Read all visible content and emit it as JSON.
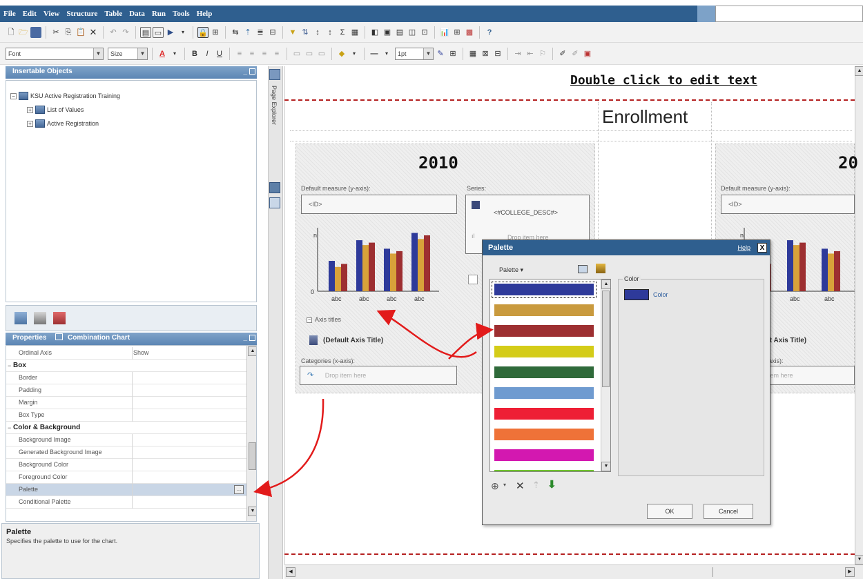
{
  "menu": {
    "items": [
      "File",
      "Edit",
      "View",
      "Structure",
      "Table",
      "Data",
      "Run",
      "Tools",
      "Help"
    ]
  },
  "format_toolbar": {
    "font_value": "Font",
    "size_value": "Size",
    "line_value": "1pt"
  },
  "insertable_objects": {
    "title": "Insertable Objects",
    "tree": [
      {
        "label": "KSU Active Registration Training",
        "level": 0,
        "expander": "−"
      },
      {
        "label": "List of Values",
        "level": 1,
        "expander": "+"
      },
      {
        "label": "Active Registration",
        "level": 1,
        "expander": "+"
      }
    ]
  },
  "page_explorer": {
    "label": "Page Explorer"
  },
  "properties": {
    "title": "Properties",
    "context": "Combination Chart",
    "rows": [
      {
        "name": "Ordinal Axis",
        "value": "Show",
        "group": false
      },
      {
        "name": "Box",
        "value": "",
        "group": true,
        "expander": "−"
      },
      {
        "name": "Border",
        "value": "",
        "group": false
      },
      {
        "name": "Padding",
        "value": "",
        "group": false
      },
      {
        "name": "Margin",
        "value": "",
        "group": false
      },
      {
        "name": "Box Type",
        "value": "",
        "group": false
      },
      {
        "name": "Color & Background",
        "value": "",
        "group": true,
        "expander": "−"
      },
      {
        "name": "Background Image",
        "value": "",
        "group": false
      },
      {
        "name": "Generated Background Image",
        "value": "",
        "group": false
      },
      {
        "name": "Background Color",
        "value": "",
        "group": false
      },
      {
        "name": "Foreground Color",
        "value": "",
        "group": false
      },
      {
        "name": "Palette",
        "value": "",
        "group": false,
        "selected": true
      },
      {
        "name": "Conditional Palette",
        "value": "",
        "group": false
      }
    ],
    "ellipsis": "...",
    "description_title": "Palette",
    "description_text": "Specifies the palette to use for the chart."
  },
  "report": {
    "header_text": "Double click to edit text",
    "enrollment_title": "Enrollment",
    "chart_left": {
      "year": "2010",
      "default_measure_label": "Default measure (y-axis):",
      "measure_value": "<ID>",
      "series_label": "Series:",
      "series_value": "<#COLLEGE_DESC#>",
      "series_drop": "Drop item here",
      "axis_n": "n",
      "axis_zero": "0",
      "x_labels": [
        "abc",
        "abc",
        "abc",
        "abc"
      ],
      "axis_titles_toggle": "Axis titles",
      "default_axis_title": "(Default Axis Title)",
      "categories_label": "Categories (x-axis):",
      "categories_drop": "Drop item here"
    },
    "chart_right": {
      "year": "20",
      "default_measure_label": "Default measure (y-axis):",
      "measure_value": "<ID>",
      "axis_n": "n",
      "x_labels": [
        "abc",
        "abc",
        "abc"
      ],
      "default_axis_title": "lt Axis Title)",
      "categories_label": "-axis):",
      "categories_drop": "item here"
    }
  },
  "palette_dialog": {
    "title": "Palette",
    "help": "Help",
    "close": "X",
    "palette_menu": "Palette ▾",
    "color_group_label": "Color",
    "color_item_label": "Color",
    "selected_color": "#2e3a9a",
    "swatches": [
      "#2e3a9a",
      "#c99a3e",
      "#9d2f31",
      "#d4cc18",
      "#2f6a3a",
      "#6f9bd0",
      "#ee1f35",
      "#ef7238",
      "#d318b0",
      "#6fc42c"
    ],
    "ok": "OK",
    "cancel": "Cancel"
  },
  "chart_bar_colors": {
    "blue": "#2e3a9a",
    "gold": "#d8a23a",
    "red": "#9d2f31"
  },
  "chart_data": {
    "type": "bar",
    "categories": [
      "abc",
      "abc",
      "abc",
      "abc"
    ],
    "series": [
      {
        "values": [
          50,
          84,
          70,
          96
        ]
      },
      {
        "values": [
          40,
          76,
          62,
          86
        ]
      },
      {
        "values": [
          45,
          80,
          66,
          92
        ]
      }
    ],
    "ylim": [
      0,
      100
    ]
  }
}
